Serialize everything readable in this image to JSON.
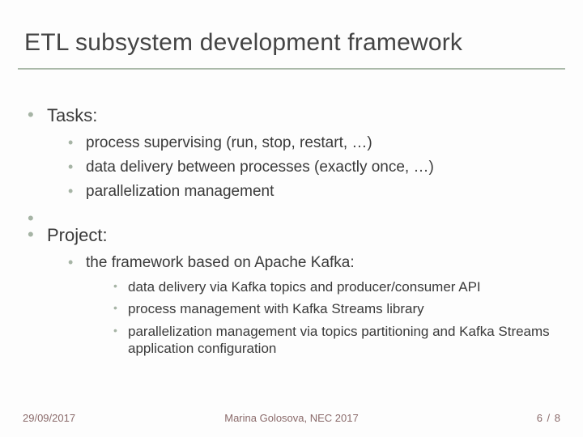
{
  "title": "ETL subsystem development framework",
  "sections": [
    {
      "heading": "Tasks:",
      "items": [
        "process supervising (run, stop, restart, …)",
        "data delivery between processes (exactly once, …)",
        "parallelization management"
      ]
    },
    {
      "heading": "Project:",
      "items_nested": [
        {
          "text": "the framework based on Apache Kafka:",
          "sub": [
            "data delivery via Kafka topics and producer/consumer API",
            "process management with Kafka Streams library",
            "parallelization management via topics partitioning and Kafka Streams application configuration"
          ]
        }
      ]
    }
  ],
  "footer": {
    "date": "29/09/2017",
    "author": "Marina Golosova, NEC 2017",
    "page_current": "6",
    "page_sep": " / ",
    "page_total": "8"
  },
  "colors": {
    "bullet": "#a6b4a5",
    "rule": "#aab9a9",
    "footer_text": "#8a6a6a"
  }
}
